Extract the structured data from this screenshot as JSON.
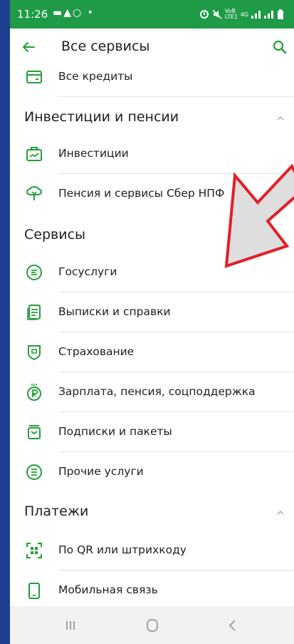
{
  "status_bar": {
    "time": "11:26",
    "left_icons": "▬▲○ •",
    "net": "VoB LTE1",
    "gen": "4G"
  },
  "header": {
    "title": "Все сервисы"
  },
  "items_top": [
    {
      "icon": "wallet-icon",
      "label": "Все кредиты"
    }
  ],
  "sections": [
    {
      "title": "Инвестиции и пенсии",
      "items": [
        {
          "icon": "briefcase-chart-icon",
          "label": "Инвестиции"
        },
        {
          "icon": "tree-icon",
          "label": "Пенсия и сервисы Сбер НПФ"
        }
      ]
    },
    {
      "title": "Сервисы",
      "items": [
        {
          "icon": "gosuslugi-icon",
          "label": "Госуслуги"
        },
        {
          "icon": "documents-icon",
          "label": "Выписки и справки"
        },
        {
          "icon": "shield-icon",
          "label": "Страхование"
        },
        {
          "icon": "ruble-coin-icon",
          "label": "Зарплата, пенсия, соцподдержка"
        },
        {
          "icon": "subscriptions-icon",
          "label": "Подписки и пакеты"
        },
        {
          "icon": "list-circle-icon",
          "label": "Прочие услуги"
        }
      ]
    },
    {
      "title": "Платежи",
      "items": [
        {
          "icon": "qr-scan-icon",
          "label": "По QR или штрихкоду"
        },
        {
          "icon": "phone-icon",
          "label": "Мобильная связь"
        }
      ]
    }
  ],
  "colors": {
    "green": "#1f9b47",
    "icon": "#21a038",
    "frame_blue": "#1c3f8f",
    "arrow_red": "#e41e26"
  }
}
